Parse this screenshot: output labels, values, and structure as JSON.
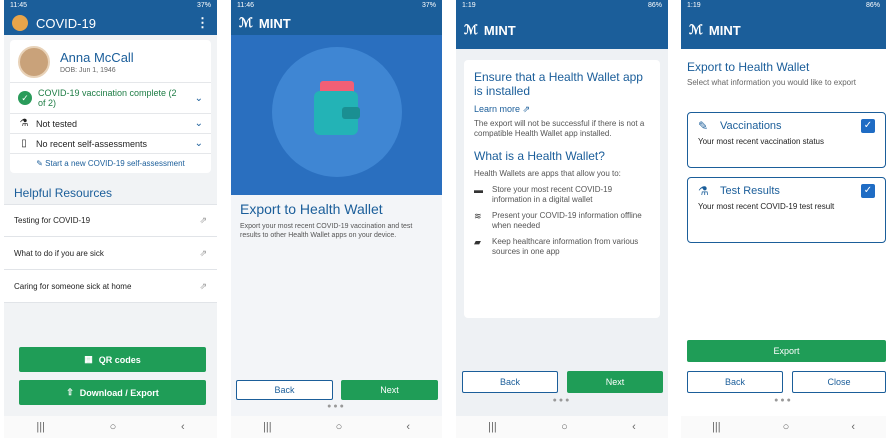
{
  "screen1": {
    "status_time": "11:45",
    "status_right": "37%",
    "app_title": "COVID-19",
    "menu_icon": "more-vert-icon",
    "profile": {
      "name": "Anna McCall",
      "dob": "DOB: Jun 1, 1946"
    },
    "vaccination_status": "COVID-19 vaccination complete (2 of 2)",
    "test_status": "Not tested",
    "self_assessment": "No recent self-assessments",
    "start_assessment": "Start a new COVID-19 self-assessment",
    "resources_title": "Helpful Resources",
    "resources": [
      {
        "label": "Testing for COVID-19"
      },
      {
        "label": "What to do if you are sick"
      },
      {
        "label": "Caring for someone sick at home"
      }
    ],
    "qr_button": "QR codes",
    "download_button": "Download / Export"
  },
  "screen2": {
    "status_time": "11:46",
    "status_right": "37%",
    "app_title": "MINT",
    "title": "Export to Health Wallet",
    "description": "Export your most recent COVID-19 vaccination and test results to other Health Wallet apps on your device.",
    "back_button": "Back",
    "next_button": "Next"
  },
  "screen3": {
    "status_time": "1:19",
    "status_right": "86%",
    "app_title": "MINT",
    "heading1": "Ensure that a Health Wallet app is installed",
    "learn_more": "Learn more",
    "paragraph1": "The export will not be successful if there is not a compatible Health Wallet app installed.",
    "heading2": "What is a Health Wallet?",
    "paragraph2": "Health Wallets are apps that allow you to:",
    "features": [
      {
        "icon": "id-card-icon",
        "text": "Store your most recent COVID-19 information in a digital wallet"
      },
      {
        "icon": "wifi-off-icon",
        "text": "Present your COVID-19 information offline when needed"
      },
      {
        "icon": "folder-icon",
        "text": "Keep healthcare information from various sources in one app"
      }
    ],
    "back_button": "Back",
    "next_button": "Next"
  },
  "screen4": {
    "status_time": "1:19",
    "status_right": "86%",
    "app_title": "MINT",
    "title": "Export to Health Wallet",
    "subtitle": "Select what information you would like to export",
    "options": [
      {
        "label": "Vaccinations",
        "description": "Your most recent vaccination status",
        "checked": true
      },
      {
        "label": "Test Results",
        "description": "Your most recent COVID-19 test result",
        "checked": true
      }
    ],
    "export_button": "Export",
    "back_button": "Back",
    "close_button": "Close"
  },
  "colors": {
    "primary": "#1b5e9a",
    "green": "#1f9d57",
    "hero": "#2a6fbf"
  }
}
